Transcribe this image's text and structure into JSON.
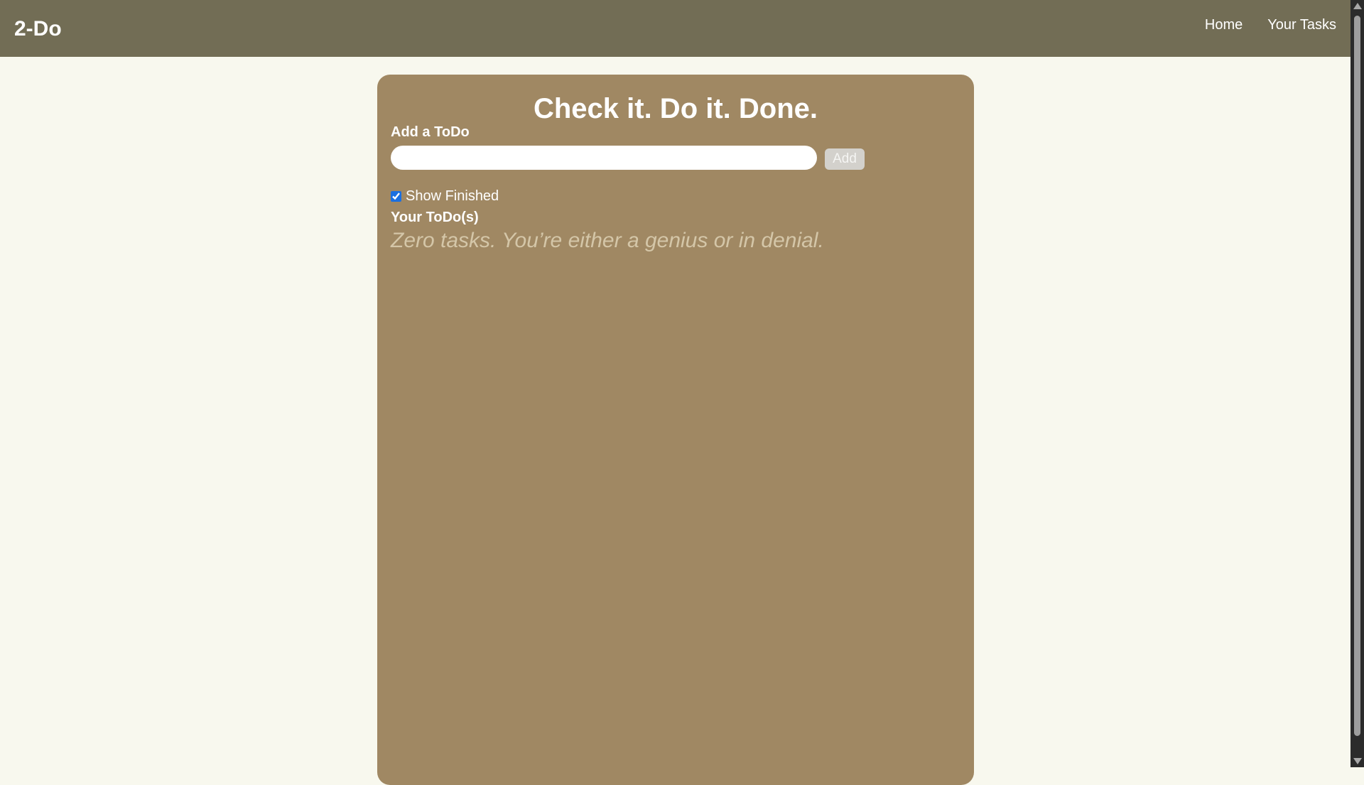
{
  "navbar": {
    "brand": "2-Do",
    "links": [
      {
        "label": "Home"
      },
      {
        "label": "Your Tasks"
      }
    ]
  },
  "main": {
    "title": "Check it. Do it. Done.",
    "add_label": "Add a ToDo",
    "input_value": "",
    "add_button_label": "Add",
    "show_finished_label": "Show Finished",
    "show_finished_checked": true,
    "todos_heading": "Your ToDo(s)",
    "empty_message": "Zero tasks. You’re either a genius or in denial."
  },
  "colors": {
    "navbar_bg": "#726d55",
    "page_bg": "#f8f8ee",
    "card_bg": "#a08863",
    "empty_text": "#d4c6a8"
  }
}
